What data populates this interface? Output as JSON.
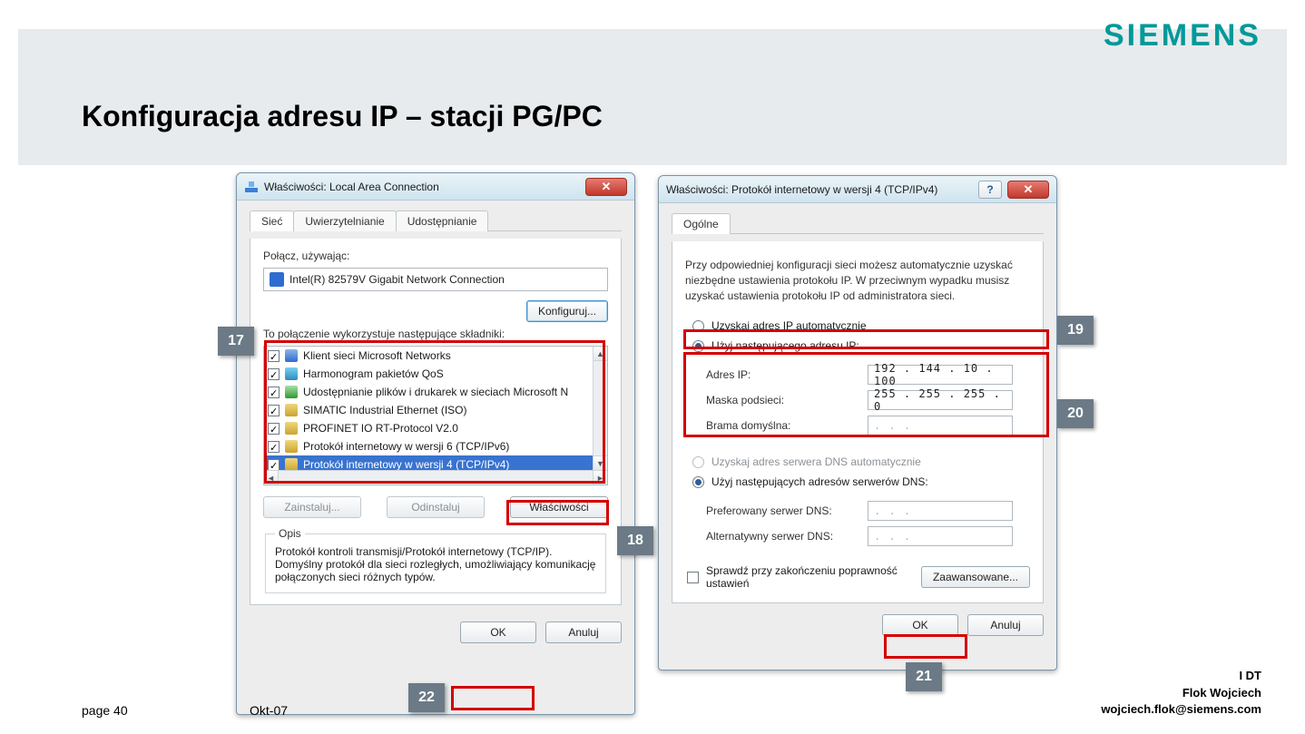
{
  "slide": {
    "title": "Konfiguracja adresu IP – stacji PG/PC",
    "brand": "SIEMENS",
    "page": "page 40",
    "date": "Okt-07",
    "dept": "I DT",
    "author": "Flok Wojciech",
    "email": "wojciech.flok@siemens.com"
  },
  "dialog1": {
    "title": "Właściwości: Local Area Connection",
    "tabs": {
      "net": "Sieć",
      "auth": "Uwierzytelnianie",
      "share": "Udostępnianie"
    },
    "connect_using": "Połącz, używając:",
    "nic": "Intel(R) 82579V Gigabit Network Connection",
    "configure": "Konfiguruj...",
    "uses_label": "To połączenie wykorzystuje następujące składniki:",
    "items": [
      "Klient sieci Microsoft Networks",
      "Harmonogram pakietów QoS",
      "Udostępnianie plików i drukarek w sieciach Microsoft N",
      "SIMATIC Industrial Ethernet (ISO)",
      "PROFINET IO RT-Protocol V2.0",
      "Protokół internetowy w wersji 6 (TCP/IPv6)",
      "Protokół internetowy w wersji 4 (TCP/IPv4)"
    ],
    "install": "Zainstaluj...",
    "uninstall": "Odinstaluj",
    "properties": "Właściwości",
    "opis_legend": "Opis",
    "opis_text": "Protokół kontroli transmisji/Protokół internetowy (TCP/IP). Domyślny protokół dla sieci rozległych, umożliwiający komunikację połączonych sieci różnych typów.",
    "ok": "OK",
    "cancel": "Anuluj"
  },
  "dialog2": {
    "title": "Właściwości: Protokół internetowy w wersji 4 (TCP/IPv4)",
    "tab_general": "Ogólne",
    "desc": "Przy odpowiedniej konfiguracji sieci możesz automatycznie uzyskać niezbędne ustawienia protokołu IP. W przeciwnym wypadku musisz uzyskać ustawienia protokołu IP od administratora sieci.",
    "radio_auto_ip": "Uzyskaj adres IP automatycznie",
    "radio_manual_ip": "Użyj następującego adresu IP:",
    "ip_label": "Adres IP:",
    "mask_label": "Maska podsieci:",
    "gw_label": "Brama domyślna:",
    "ip_value": "192 . 144 .  10  . 100",
    "mask_value": "255 . 255 . 255 .   0",
    "gw_value": ".       .       .",
    "radio_auto_dns": "Uzyskaj adres serwera DNS automatycznie",
    "radio_manual_dns": "Użyj następujących adresów serwerów DNS:",
    "dns_pref": "Preferowany serwer DNS:",
    "dns_alt": "Alternatywny serwer DNS:",
    "dns_blank": ".       .       .",
    "validate": "Sprawdź przy zakończeniu poprawność ustawień",
    "advanced": "Zaawansowane...",
    "ok": "OK",
    "cancel": "Anuluj"
  },
  "callouts": {
    "c17": "17",
    "c18": "18",
    "c19": "19",
    "c20": "20",
    "c21": "21",
    "c22": "22"
  }
}
